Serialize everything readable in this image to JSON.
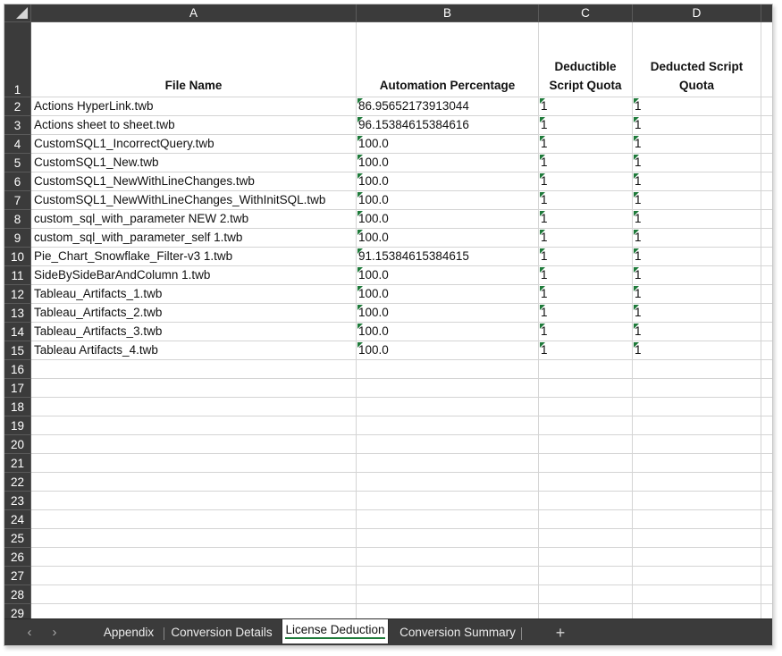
{
  "columns": [
    "A",
    "B",
    "C",
    "D"
  ],
  "header_row": {
    "row_number": "1",
    "cells": [
      "File Name",
      "Automation Percentage",
      "Deductible Script Quota",
      "Deducted Script Quota"
    ]
  },
  "rows": [
    {
      "n": "2",
      "a": "Actions HyperLink.twb",
      "b": "86.95652173913044",
      "c": "1",
      "d": "1"
    },
    {
      "n": "3",
      "a": "Actions sheet to sheet.twb",
      "b": "96.15384615384616",
      "c": "1",
      "d": "1"
    },
    {
      "n": "4",
      "a": "CustomSQL1_IncorrectQuery.twb",
      "b": "100.0",
      "c": "1",
      "d": "1"
    },
    {
      "n": "5",
      "a": "CustomSQL1_New.twb",
      "b": "100.0",
      "c": "1",
      "d": "1"
    },
    {
      "n": "6",
      "a": "CustomSQL1_NewWithLineChanges.twb",
      "b": "100.0",
      "c": "1",
      "d": "1"
    },
    {
      "n": "7",
      "a": "CustomSQL1_NewWithLineChanges_WithInitSQL.twb",
      "b": "100.0",
      "c": "1",
      "d": "1"
    },
    {
      "n": "8",
      "a": "custom_sql_with_parameter NEW 2.twb",
      "b": "100.0",
      "c": "1",
      "d": "1"
    },
    {
      "n": "9",
      "a": "custom_sql_with_parameter_self 1.twb",
      "b": "100.0",
      "c": "1",
      "d": "1"
    },
    {
      "n": "10",
      "a": "Pie_Chart_Snowflake_Filter-v3 1.twb",
      "b": "91.15384615384615",
      "c": "1",
      "d": "1"
    },
    {
      "n": "11",
      "a": "SideBySideBarAndColumn 1.twb",
      "b": "100.0",
      "c": "1",
      "d": "1"
    },
    {
      "n": "12",
      "a": "Tableau_Artifacts_1.twb",
      "b": "100.0",
      "c": "1",
      "d": "1"
    },
    {
      "n": "13",
      "a": "Tableau_Artifacts_2.twb",
      "b": "100.0",
      "c": "1",
      "d": "1"
    },
    {
      "n": "14",
      "a": "Tableau_Artifacts_3.twb",
      "b": "100.0",
      "c": "1",
      "d": "1"
    },
    {
      "n": "15",
      "a": "Tableau Artifacts_4.twb",
      "b": "100.0",
      "c": "1",
      "d": "1"
    }
  ],
  "empty_rows": [
    "16",
    "17",
    "18",
    "19",
    "20",
    "21",
    "22",
    "23",
    "24",
    "25",
    "26",
    "27",
    "28",
    "29"
  ],
  "tabs": {
    "prev": "‹",
    "next": "›",
    "items": [
      "Appendix",
      "Conversion Details",
      "License Deduction",
      "Conversion Summary"
    ],
    "active": "License Deduction",
    "add": "+"
  },
  "colors": {
    "header_bg": "#3b3b3b",
    "marker": "#1e7a3a",
    "grid": "#d4d4d4"
  }
}
